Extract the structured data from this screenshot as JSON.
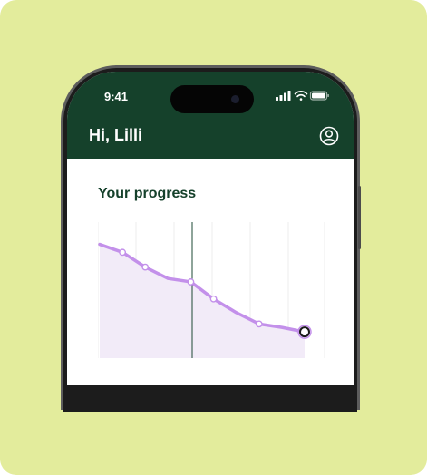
{
  "status_bar": {
    "time": "9:41",
    "icons": [
      "signal-icon",
      "wifi-icon",
      "battery-icon"
    ]
  },
  "header": {
    "greeting": "Hi, Lilli",
    "profile_icon": "user-circle-icon"
  },
  "progress": {
    "title": "Your progress"
  },
  "colors": {
    "background": "#e3ec9c",
    "header_green": "#15412b",
    "line": "#c390ea",
    "area_fill": "#f2ebf8",
    "marker_ring": "#c390ea"
  },
  "chart_data": {
    "type": "line",
    "title": "",
    "xlabel": "",
    "ylabel": "",
    "grid": "vertical",
    "y_axis": "none",
    "x": [
      1,
      2,
      3,
      4,
      5,
      6,
      7,
      8,
      9,
      10
    ],
    "series": [
      {
        "values": [
          100,
          93,
          80,
          70,
          67,
          52,
          40,
          30,
          27,
          23
        ]
      }
    ],
    "ylim": [
      0,
      110
    ],
    "highlighted_index": 9
  }
}
